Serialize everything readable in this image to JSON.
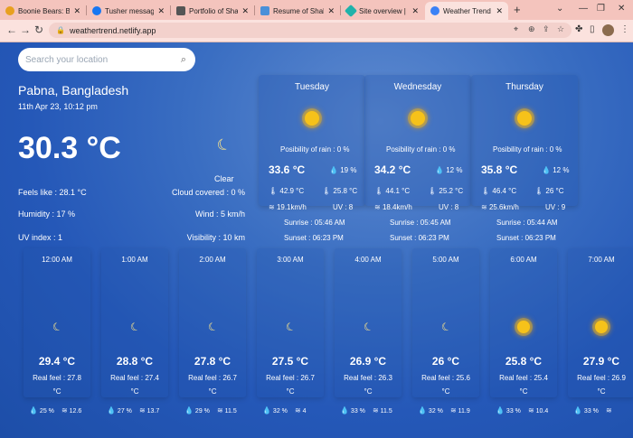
{
  "tabs": [
    {
      "label": "Boonie Bears: Back to",
      "icon_color": "#e8a020"
    },
    {
      "label": "Tusher messaged US A",
      "icon_color": "#1877f2"
    },
    {
      "label": "Portfolio of Shahid",
      "icon_color": "#555555"
    },
    {
      "label": "Resume of Shahidul Is",
      "icon_color": "#4a90d9"
    },
    {
      "label": "Site overview | weath",
      "icon_color": "#20b2aa"
    },
    {
      "label": "Weather Trend App",
      "icon_color": "#3b82f6"
    }
  ],
  "url": "weathertrend.netlify.app",
  "search": {
    "placeholder": "Search your location"
  },
  "current": {
    "location": "Pabna, Bangladesh",
    "datetime": "11th Apr 23, 10:12 pm",
    "temp": "30.3 °C",
    "condition": "Clear",
    "feels_like": "Feels like : 28.1 °C",
    "humidity": "Humidity : 17 %",
    "uv": "UV index : 1",
    "cloud": "Cloud covered : 0 %",
    "wind": "Wind : 5 km/h",
    "visibility": "Visibility : 10 km"
  },
  "days": [
    {
      "name": "Tuesday",
      "rain": "Posibility of rain : 0 %",
      "temp": "33.6 °C",
      "humid": "19 %",
      "max": "42.9 °C",
      "min": "25.8 °C",
      "wind": "19.1km/h",
      "uv": "UV : 8",
      "sunrise": "Sunrise : 05:46 AM",
      "sunset": "Sunset : 06:23 PM"
    },
    {
      "name": "Wednesday",
      "rain": "Posibility of rain : 0 %",
      "temp": "34.2 °C",
      "humid": "12 %",
      "max": "44.1 °C",
      "min": "25.2 °C",
      "wind": "18.4km/h",
      "uv": "UV : 8",
      "sunrise": "Sunrise : 05:45 AM",
      "sunset": "Sunset : 06:23 PM"
    },
    {
      "name": "Thursday",
      "rain": "Posibility of rain : 0 %",
      "temp": "35.8 °C",
      "humid": "12 %",
      "max": "46.4 °C",
      "min": "26 °C",
      "wind": "25.6km/h",
      "uv": "UV : 9",
      "sunrise": "Sunrise : 05:44 AM",
      "sunset": "Sunset : 06:23 PM"
    }
  ],
  "hours": [
    {
      "time": "12:00 AM",
      "icon": "moon",
      "temp": "29.4 °C",
      "real": "Real feel : 27.8",
      "unit": "°C",
      "hum": "25 %",
      "wind": "12.6"
    },
    {
      "time": "1:00 AM",
      "icon": "moon",
      "temp": "28.8 °C",
      "real": "Real feel : 27.4",
      "unit": "°C",
      "hum": "27 %",
      "wind": "13.7"
    },
    {
      "time": "2:00 AM",
      "icon": "moon",
      "temp": "27.8 °C",
      "real": "Real feel : 26.7",
      "unit": "°C",
      "hum": "29 %",
      "wind": "11.5"
    },
    {
      "time": "3:00 AM",
      "icon": "moon",
      "temp": "27.5 °C",
      "real": "Real feel : 26.7",
      "unit": "°C",
      "hum": "32 %",
      "wind": "4"
    },
    {
      "time": "4:00 AM",
      "icon": "moon",
      "temp": "26.9 °C",
      "real": "Real feel : 26.3",
      "unit": "°C",
      "hum": "33 %",
      "wind": "11.5"
    },
    {
      "time": "5:00 AM",
      "icon": "moon",
      "temp": "26 °C",
      "real": "Real feel : 25.6",
      "unit": "°C",
      "hum": "32 %",
      "wind": "11.9"
    },
    {
      "time": "6:00 AM",
      "icon": "sun",
      "temp": "25.8 °C",
      "real": "Real feel : 25.4",
      "unit": "°C",
      "hum": "33 %",
      "wind": "10.4"
    },
    {
      "time": "7:00 AM",
      "icon": "sun",
      "temp": "27.9 °C",
      "real": "Real feel : 26.9",
      "unit": "°C",
      "hum": "33 %",
      "wind": ""
    }
  ],
  "colors": {
    "accent": "#1d4ea8",
    "sun": "#f6c21a",
    "moon": "#fde68a",
    "tabbar": "#f4c4bd"
  }
}
